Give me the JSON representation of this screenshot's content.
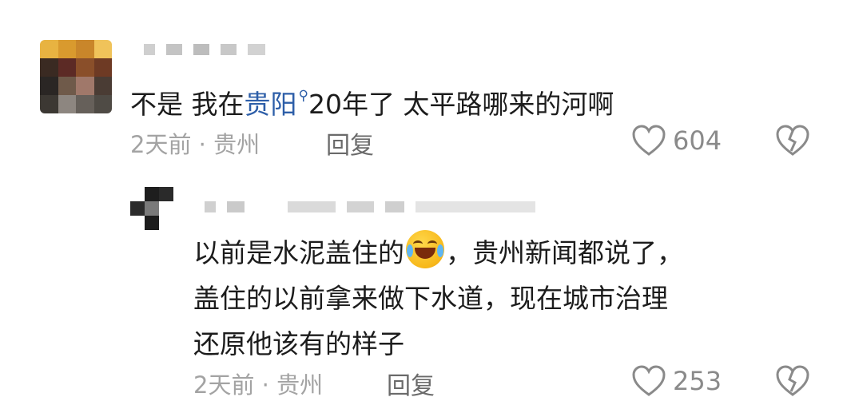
{
  "comments": [
    {
      "text_before": "不是 我在",
      "link": "贵阳",
      "text_after": "20年了 太平路哪来的河啊",
      "meta": "2天前 · 贵州",
      "reply_label": "回复",
      "likes": "604"
    }
  ],
  "reply": {
    "line1_before": "以前是水泥盖住的",
    "line1_after": "，贵州新闻都说了，",
    "line2": "盖住的以前拿来做下水道，现在城市治理",
    "line3": "还原他该有的样子",
    "meta": "2天前 · 贵州",
    "reply_label": "回复",
    "likes": "253"
  },
  "icons": {
    "like": "heart-outline-icon",
    "dislike": "broken-heart-icon",
    "search": "search-mark-icon",
    "emoji": "laughing-tears-emoji"
  },
  "colors": {
    "link": "#2d5ea8",
    "meta": "#a3a3a3",
    "text": "#1c1c1c"
  }
}
